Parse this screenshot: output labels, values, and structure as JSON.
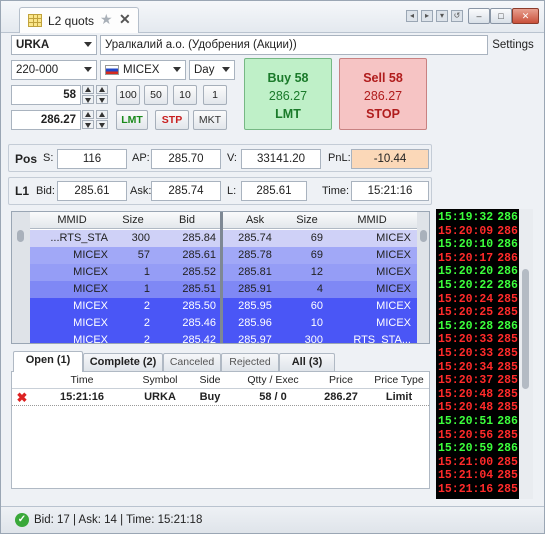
{
  "window": {
    "tab_title": "L2 quots"
  },
  "symbol_bar": {
    "symbol": "URKA",
    "description": "Уралкалий а.о. (Удобрения (Акции))",
    "settings_label": "Settings"
  },
  "order_form": {
    "account": "220-000",
    "exchange": "MICEX",
    "duration": "Day",
    "quantity": "58",
    "price": "286.27",
    "qty_presets": [
      "100",
      "50",
      "10",
      "1"
    ],
    "order_types": {
      "lmt": "LMT",
      "stp": "STP",
      "mkt": "MKT"
    },
    "buy": {
      "title": "Buy 58",
      "price": "286.27",
      "type": "LMT"
    },
    "sell": {
      "title": "Sell 58",
      "price": "286.27",
      "type": "STOP"
    }
  },
  "position": {
    "label": "Pos",
    "s_label": "S:",
    "s": "116",
    "ap_label": "AP:",
    "ap": "285.70",
    "v_label": "V:",
    "v": "33141.20",
    "pnl_label": "PnL:",
    "pnl": "-10.44"
  },
  "level1": {
    "label": "L1",
    "bid_label": "Bid:",
    "bid": "285.61",
    "ask_label": "Ask:",
    "ask": "285.74",
    "l_label": "L:",
    "l": "285.61",
    "time_label": "Time:",
    "time": "15:21:16"
  },
  "book": {
    "headers": {
      "mmid": "MMID",
      "size": "Size",
      "bid": "Bid",
      "ask": "Ask",
      "size2": "Size",
      "mmid2": "MMID"
    },
    "rows": [
      {
        "bid_mmid": "...RTS_STA",
        "bid_size": "300",
        "bid": "285.84",
        "ask": "285.74",
        "ask_size": "69",
        "ask_mmid": "MICEX"
      },
      {
        "bid_mmid": "MICEX",
        "bid_size": "57",
        "bid": "285.61",
        "ask": "285.78",
        "ask_size": "69",
        "ask_mmid": "MICEX"
      },
      {
        "bid_mmid": "MICEX",
        "bid_size": "1",
        "bid": "285.52",
        "ask": "285.81",
        "ask_size": "12",
        "ask_mmid": "MICEX"
      },
      {
        "bid_mmid": "MICEX",
        "bid_size": "1",
        "bid": "285.51",
        "ask": "285.91",
        "ask_size": "4",
        "ask_mmid": "MICEX"
      },
      {
        "bid_mmid": "MICEX",
        "bid_size": "2",
        "bid": "285.50",
        "ask": "285.95",
        "ask_size": "60",
        "ask_mmid": "MICEX"
      },
      {
        "bid_mmid": "MICEX",
        "bid_size": "2",
        "bid": "285.46",
        "ask": "285.96",
        "ask_size": "10",
        "ask_mmid": "MICEX"
      },
      {
        "bid_mmid": "MICEX",
        "bid_size": "2",
        "bid": "285.42",
        "ask": "285.97",
        "ask_size": "300",
        "ask_mmid": "RTS_STA..."
      }
    ]
  },
  "orders": {
    "tabs": [
      "Open (1)",
      "Complete (2)",
      "Canceled",
      "Rejected",
      "All (3)"
    ],
    "headers": {
      "time": "Time",
      "symbol": "Symbol",
      "side": "Side",
      "qty": "Qtty / Exec",
      "price": "Price",
      "price_type": "Price Type"
    },
    "rows": [
      {
        "time": "15:21:16",
        "symbol": "URKA",
        "side": "Buy",
        "qty": "58 / 0",
        "price": "286.27",
        "price_type": "Limit"
      }
    ]
  },
  "tape": [
    {
      "time": "15:19:32",
      "price": "286",
      "color": "green"
    },
    {
      "time": "15:20:09",
      "price": "286",
      "color": "red"
    },
    {
      "time": "15:20:10",
      "price": "286",
      "color": "green"
    },
    {
      "time": "15:20:17",
      "price": "286",
      "color": "red"
    },
    {
      "time": "15:20:20",
      "price": "286",
      "color": "green"
    },
    {
      "time": "15:20:22",
      "price": "286",
      "color": "green"
    },
    {
      "time": "15:20:24",
      "price": "285",
      "color": "red"
    },
    {
      "time": "15:20:25",
      "price": "285",
      "color": "red"
    },
    {
      "time": "15:20:28",
      "price": "286",
      "color": "green"
    },
    {
      "time": "15:20:33",
      "price": "285",
      "color": "red"
    },
    {
      "time": "15:20:33",
      "price": "285",
      "color": "red"
    },
    {
      "time": "15:20:34",
      "price": "285",
      "color": "red"
    },
    {
      "time": "15:20:37",
      "price": "285",
      "color": "red"
    },
    {
      "time": "15:20:48",
      "price": "285",
      "color": "red"
    },
    {
      "time": "15:20:48",
      "price": "285",
      "color": "red"
    },
    {
      "time": "15:20:51",
      "price": "286",
      "color": "green"
    },
    {
      "time": "15:20:56",
      "price": "285",
      "color": "red"
    },
    {
      "time": "15:20:59",
      "price": "286",
      "color": "green"
    },
    {
      "time": "15:21:00",
      "price": "285",
      "color": "red"
    },
    {
      "time": "15:21:04",
      "price": "285",
      "color": "red"
    },
    {
      "time": "15:21:16",
      "price": "285",
      "color": "red"
    }
  ],
  "status": {
    "text": "Bid: 17 | Ask: 14 | Time: 15:21:18"
  },
  "colors": {
    "tape_green": "#3cff3c",
    "tape_red": "#ff2a2a",
    "buy_bg": "#bff0c8",
    "sell_bg": "#f6c4c4",
    "bid_top": "#c9ccf6",
    "bid_mid": "#9aa2f7",
    "bid_deep": "#4450f6",
    "pnl_bg": "#fbd8b8"
  }
}
